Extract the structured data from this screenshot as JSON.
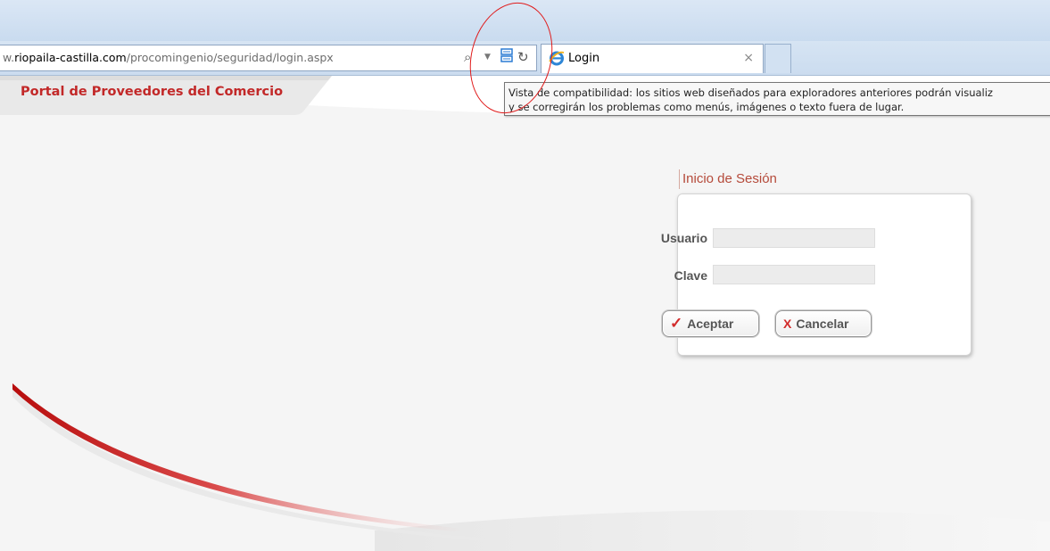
{
  "browser": {
    "address": {
      "prefix": "w.",
      "domain": "riopaila-castilla.com",
      "path": "/procomingenio/seguridad/login.aspx"
    },
    "icons": {
      "search": "search-icon",
      "dropdown": "dropdown-arrow-icon",
      "compat": "compatibility-view-icon",
      "refresh": "refresh-icon"
    },
    "tab": {
      "label": "Login",
      "close": "×"
    }
  },
  "page": {
    "portal_title": "Portal de Proveedores del Comercio",
    "tooltip": {
      "line1": "Vista de compatibilidad: los sitios web diseñados para exploradores anteriores podrán visualiz",
      "line2": "y se corregirán los problemas como menús, imágenes o texto fuera de lugar."
    },
    "login": {
      "heading": "Inicio de Sesión",
      "user_label": "Usuario",
      "pass_label": "Clave",
      "accept_label": "Aceptar",
      "cancel_label": "Cancelar"
    }
  },
  "colors": {
    "brand_red": "#c22828",
    "annotation": "#e01b1b"
  }
}
